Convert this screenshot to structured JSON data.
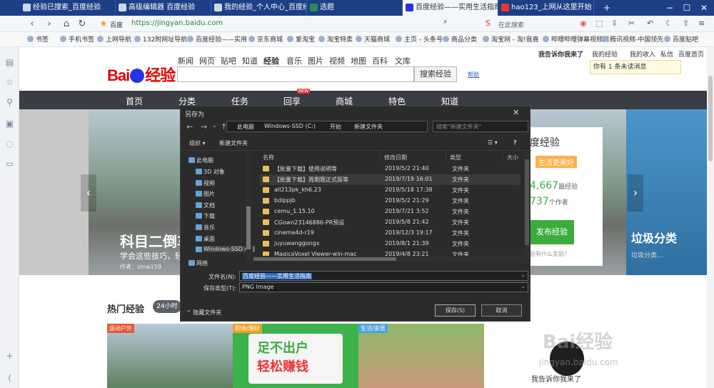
{
  "browser": {
    "tabs": [
      {
        "label": "经验已搜索_百度经验",
        "active": false
      },
      {
        "label": "高级编辑器 百度经验",
        "active": false
      },
      {
        "label": "我的经验_个人中心_百度经验",
        "active": false
      },
      {
        "label": "选题",
        "active": false
      },
      {
        "label": "百度经验——实用生活指南",
        "active": true
      },
      {
        "label": "hao123_上网从这里开始",
        "active": false
      }
    ],
    "window_controls": [
      "−",
      "☐",
      "✕"
    ],
    "site_label": "百度",
    "url": "https://jingyan.baidu.com",
    "search_placeholder": "在此搜索",
    "bookmarks": [
      "书签",
      "手机书签",
      "上网导航",
      "132附网址导航",
      "百度经验——实用",
      "京东商城",
      "爱淘宝",
      "淘宝特卖",
      "天猫商城",
      "主页 - 头条号",
      "商品分类",
      "淘宝网 - 淘!我喜",
      "哔哩哔哩弹幕视频网",
      "腾讯视频-中国领先",
      "百度贴吧"
    ]
  },
  "page": {
    "logo_text_a": "Bai",
    "logo_text_b": "经验",
    "search_tabs": [
      "新闻",
      "网页",
      "贴吧",
      "知道",
      "经验",
      "音乐",
      "图片",
      "视频",
      "地图",
      "百科",
      "文库"
    ],
    "search_button": "搜索经验",
    "help_link": "帮助",
    "user_links": {
      "greeting": "我告诉你我来了",
      "my_exp": "我的经验",
      "income": "我的收入",
      "mail": "私信",
      "home": "百度首页"
    },
    "message_notice": "你有 1 条未读消息",
    "nav_items": [
      "首页",
      "分类",
      "任务",
      "回享",
      "商城",
      "特色",
      "知道"
    ],
    "new_badge": "NEW",
    "banner": {
      "headline": "科目二倒车",
      "subline": "学会这些技巧，轻松",
      "author": "作者：zmw159"
    },
    "right_panel": {
      "title": "度经验",
      "tagline": "生活更美好",
      "stat1_value": "4,667",
      "stat1_unit": "篇经验",
      "stat2_value": "737",
      "stat2_unit": "个作者",
      "publish_button": "发布经验",
      "note": "验有什么奖励？"
    },
    "banner_right": {
      "headline": "垃圾分类",
      "subline": "垃圾分类..."
    },
    "hot_title": "热门经验",
    "hot_pill": "24小时",
    "cards": [
      {
        "tag": "运动户外",
        "tag_color": "#e8573a"
      },
      {
        "tag": "职场/理财",
        "tag_color": "#f0a020",
        "text_a": "足不出户",
        "text_b": "轻松赚钱"
      },
      {
        "tag": "生活/家居",
        "tag_color": "#4aa3df"
      }
    ],
    "watermark": {
      "text": "Bai经验",
      "url": "jingyan.baidu.com",
      "caption": "我告诉你我来了"
    }
  },
  "dialog": {
    "title": "另存为",
    "close": "✕",
    "breadcrumbs": [
      "此电脑",
      "Windows-SSD (C:)",
      "开始",
      "新建文件夹"
    ],
    "search_placeholder": "搜索\"新建文件夹\"",
    "toolbar": {
      "organize": "组织 ▾",
      "new_folder": "新建文件夹"
    },
    "tree": [
      "此电脑",
      "3D 对象",
      "视频",
      "图片",
      "文档",
      "下载",
      "音乐",
      "桌面",
      "Windows-SSD (C:)",
      "网络"
    ],
    "columns": {
      "name": "名称",
      "date": "修改日期",
      "type": "类型",
      "size": "大小"
    },
    "files": [
      {
        "name": "【批量下载】使用说明等",
        "date": "2019/5/2 21:40",
        "type": "文件夹"
      },
      {
        "name": "【批量下载】周期题正式版等",
        "date": "2019/7/19 16:01",
        "type": "文件夹"
      },
      {
        "name": "all213pk_kh6.23",
        "date": "2019/5/18 17:38",
        "type": "文件夹"
      },
      {
        "name": "bdlppjb",
        "date": "2019/5/2 21:29",
        "type": "文件夹"
      },
      {
        "name": "cemu_1.15.10",
        "date": "2019/7/21 3:52",
        "type": "文件夹"
      },
      {
        "name": "CGown23146886-PR预设",
        "date": "2019/5/8 21:42",
        "type": "文件夹"
      },
      {
        "name": "cinema4d-r19",
        "date": "2019/12/3 19:17",
        "type": "文件夹"
      },
      {
        "name": "juyuwanggongx",
        "date": "2019/8/1 21:39",
        "type": "文件夹"
      },
      {
        "name": "MagicaVoxel Viewer-win-mac",
        "date": "2019/4/8 23:21",
        "type": "文件夹"
      }
    ],
    "filename_label": "文件名(N):",
    "filename_value": "百度经验——实用生活指南",
    "filetype_label": "保存类型(T):",
    "filetype_value": "PNG Image",
    "hide_folders": "隐藏文件夹",
    "save_button": "保存(S)",
    "cancel_button": "取消"
  }
}
